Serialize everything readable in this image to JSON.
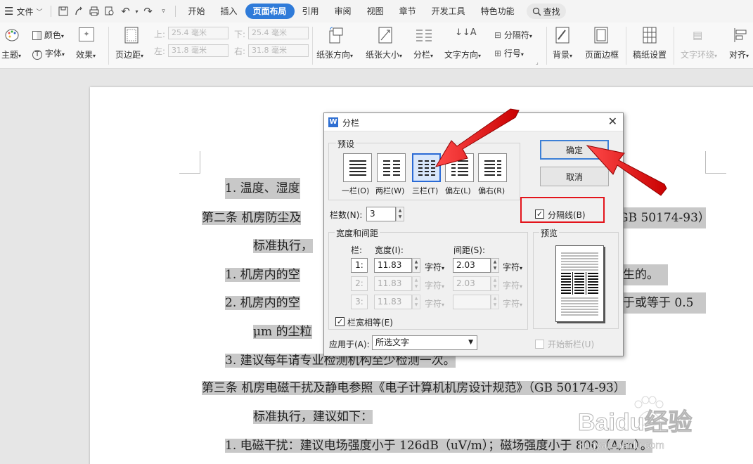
{
  "menubar": {
    "file_label": "文件",
    "tabs": [
      "开始",
      "插入",
      "页面布局",
      "引用",
      "审阅",
      "视图",
      "章节",
      "开发工具",
      "特色功能"
    ],
    "active_tab": "页面布局",
    "search_label": "查找"
  },
  "ribbon": {
    "theme_label": "主题",
    "color_label": "颜色",
    "font_label": "字体",
    "effect_label": "效果",
    "margin_label": "页边距",
    "top_label": "上:",
    "top_value": "25.4 毫米",
    "bottom_label": "下:",
    "bottom_value": "25.4 毫米",
    "left_label": "左:",
    "left_value": "31.8 毫米",
    "right_label": "右:",
    "right_value": "31.8 毫米",
    "orientation_label": "纸张方向",
    "size_label": "纸张大小",
    "columns_label": "分栏",
    "text_direction_label": "文字方向",
    "breaks_label": "分隔符",
    "line_numbers_label": "行号",
    "background_label": "背景",
    "page_border_label": "页面边框",
    "manuscript_label": "稿纸设置",
    "text_wrap_label": "文字环绕",
    "align_label": "对齐"
  },
  "document": {
    "lines": [
      "1.  温度、湿度",
      "第二条  机房防尘及",
      "GB 50174-93）",
      "标准执行，",
      "1.  机房内的空",
      "生的。",
      "2.  机房内的空",
      "于或等于 0.5",
      "μm 的尘粒",
      "3.  建议每年请专业检测机构至少检测一次。",
      "第三条  机房电磁干扰及静电参照《电子计算机机房设计规范》（GB 50174-93）",
      "标准执行，建议如下：",
      "1.  电磁干扰：建议电场强度小于 126dB（uV/m）；磁场强度小于 800（A/m）。"
    ]
  },
  "dialog": {
    "title": "分栏",
    "presets_group": "预设",
    "presets": [
      "一栏(O)",
      "两栏(W)",
      "三栏(T)",
      "偏左(L)",
      "偏右(R)"
    ],
    "selected_preset": "三栏(T)",
    "ok_label": "确定",
    "cancel_label": "取消",
    "column_count_label": "栏数(N):",
    "column_count_value": "3",
    "separator_label": "分隔线(B)",
    "separator_checked": true,
    "width_spacing_group": "宽度和间距",
    "col_header": "栏:",
    "width_header": "宽度(I):",
    "spacing_header": "间距(S):",
    "rows": [
      {
        "num": "1:",
        "width": "11.83",
        "width_unit": "字符",
        "spacing": "2.03",
        "spacing_unit": "字符"
      },
      {
        "num": "2:",
        "width": "11.83",
        "width_unit": "字符",
        "spacing": "2.03",
        "spacing_unit": "字符"
      },
      {
        "num": "3:",
        "width": "11.83",
        "width_unit": "字符",
        "spacing": "",
        "spacing_unit": "字符"
      }
    ],
    "equal_width_label": "栏宽相等(E)",
    "equal_width_checked": true,
    "preview_label": "预览",
    "apply_to_label": "应用于(A):",
    "apply_to_value": "所选文字",
    "new_column_label": "开始新栏(U)",
    "new_column_checked": false
  },
  "watermark": {
    "brand": "Baidu经验",
    "url": "jingyan.baidu.com"
  },
  "colors": {
    "accent": "#2f7bd9",
    "annotation_red": "#e3141b",
    "text_highlight": "#c8c8c8"
  }
}
